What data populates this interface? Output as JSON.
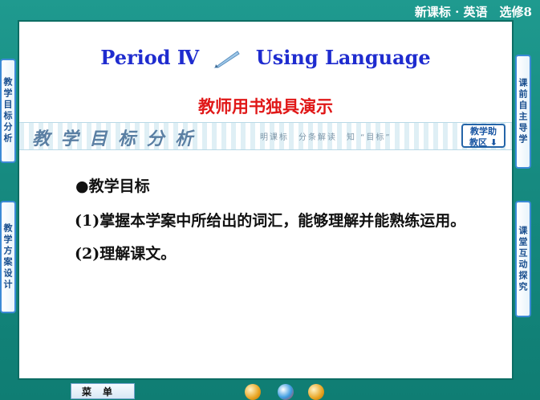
{
  "header": {
    "course": "新课标 · 英语　选修8"
  },
  "slide": {
    "title_left": "Period Ⅳ",
    "title_right": "Using Language",
    "subtitle": "教师用书独具演示",
    "banner": {
      "title": "教 学 目 标 分 析",
      "hint": "明课标　分条解读　知 “目标”",
      "button": "教学助\n教区 ⬇"
    },
    "content": {
      "bullet": "●教学目标",
      "item1": "(1)掌握本学案中所给出的词汇，能够理解并能熟练运用。",
      "item2": "(2)理解课文。"
    }
  },
  "left_tabs": [
    "教学目标分析",
    "教学方案设计"
  ],
  "right_tabs": [
    "课前自主导学",
    "课堂互动探究"
  ],
  "bottom": {
    "menu": "菜单"
  },
  "colors": {
    "title": "#1f2ccf",
    "subtitle": "#e01818",
    "background": "#168a80"
  }
}
